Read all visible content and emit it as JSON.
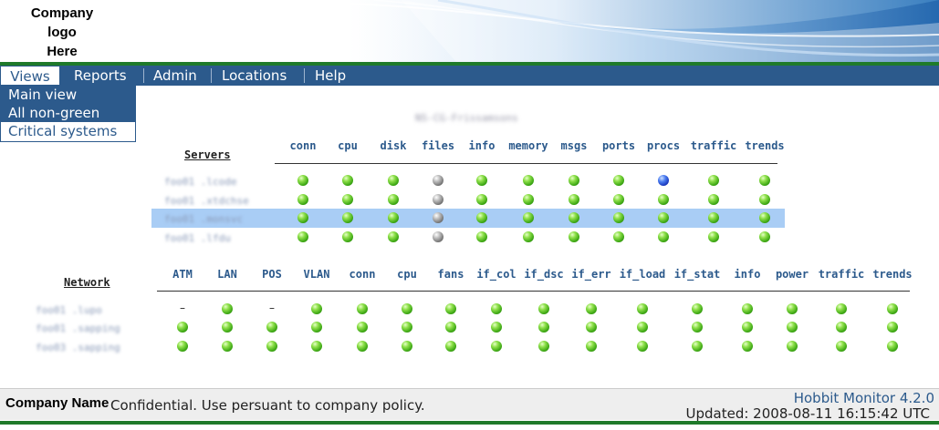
{
  "logo": {
    "lines": [
      "Company",
      "logo",
      "Here"
    ]
  },
  "menu": {
    "items": [
      "Views",
      "Reports",
      "Admin",
      "Locations",
      "Help"
    ]
  },
  "views_dropdown": {
    "items": [
      "Main view",
      "All non-green",
      "Critical systems"
    ]
  },
  "page_title": "NS-CG-Frissamsons",
  "servers": {
    "title": "Servers",
    "columns": [
      "conn",
      "cpu",
      "disk",
      "files",
      "info",
      "memory",
      "msgs",
      "ports",
      "procs",
      "traffic",
      "trends"
    ],
    "hosts": [
      "foo01 .lcode",
      "foo01 .xtdchse",
      "foo01 .monsvc",
      "foo01 .lfdu"
    ],
    "highlighted_row": 2,
    "status": [
      [
        "green",
        "green",
        "green",
        "gray",
        "green",
        "green",
        "green",
        "green",
        "blue",
        "green",
        "green"
      ],
      [
        "green",
        "green",
        "green",
        "gray",
        "green",
        "green",
        "green",
        "green",
        "green",
        "green",
        "green"
      ],
      [
        "green",
        "green",
        "green",
        "gray",
        "green",
        "green",
        "green",
        "green",
        "green",
        "green",
        "green"
      ],
      [
        "green",
        "green",
        "green",
        "gray",
        "green",
        "green",
        "green",
        "green",
        "green",
        "green",
        "green"
      ]
    ]
  },
  "network": {
    "title": "Network",
    "columns": [
      "ATM",
      "LAN",
      "POS",
      "VLAN",
      "conn",
      "cpu",
      "fans",
      "if_col",
      "if_dsc",
      "if_err",
      "if_load",
      "if_stat",
      "info",
      "power",
      "traffic",
      "trends"
    ],
    "hosts": [
      "foo01 .lupo",
      "foo01 .sapping",
      "foo03 .sapping"
    ],
    "status": [
      [
        "none",
        "green",
        "none",
        "green",
        "green",
        "green",
        "green",
        "green",
        "green",
        "green",
        "green",
        "green",
        "green",
        "green",
        "green",
        "green"
      ],
      [
        "green",
        "green",
        "green",
        "green",
        "green",
        "green",
        "green",
        "green",
        "green",
        "green",
        "green",
        "green",
        "green",
        "green",
        "green",
        "green"
      ],
      [
        "green",
        "green",
        "green",
        "green",
        "green",
        "green",
        "green",
        "green",
        "green",
        "green",
        "green",
        "green",
        "green",
        "green",
        "green",
        "green"
      ]
    ]
  },
  "footer": {
    "company_name": "Company Name",
    "confidential": "Confidential. Use persuant to company policy.",
    "product": "Hobbit Monitor 4.2.0",
    "updated": "Updated: 2008-08-11 16:15:42 UTC"
  },
  "colors": {
    "menubar": "#2c5a8c",
    "accent_green": "#1f7a2a",
    "highlight": "#a9cdf5"
  }
}
